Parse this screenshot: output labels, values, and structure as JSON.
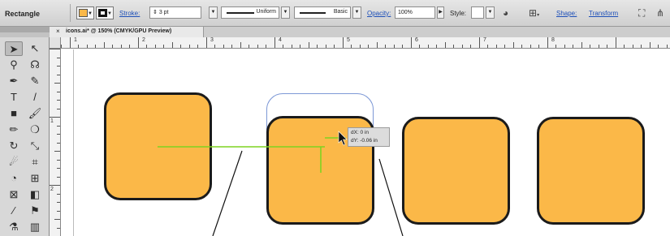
{
  "control_bar": {
    "tool_name": "Rectangle",
    "fill_color": "#fbb848",
    "stroke_color": "#111111",
    "stroke_label": "Stroke:",
    "stroke_weight": "3 pt",
    "profile": "Uniform",
    "brush": "Basic",
    "opacity_label": "Opacity:",
    "opacity_value": "100%",
    "style_label": "Style:",
    "shape_label": "Shape:",
    "transform_label": "Transform"
  },
  "document_tab": {
    "close_glyph": "×",
    "title": "icons.ai* @ 150% (CMYK/GPU Preview)"
  },
  "ruler": {
    "h_numbers": [
      "1",
      "2",
      "3",
      "4",
      "5",
      "6",
      "7",
      "8"
    ],
    "v_numbers": [
      "1",
      "2"
    ]
  },
  "tools": [
    {
      "name": "selection-tool-icon",
      "glyph": "➤"
    },
    {
      "name": "direct-selection-tool-icon",
      "glyph": "↖"
    },
    {
      "name": "magic-wand-tool-icon",
      "glyph": "⚲"
    },
    {
      "name": "lasso-tool-icon",
      "glyph": "☊"
    },
    {
      "name": "pen-tool-icon",
      "glyph": "✒"
    },
    {
      "name": "curvature-tool-icon",
      "glyph": "✎"
    },
    {
      "name": "type-tool-icon",
      "glyph": "T"
    },
    {
      "name": "line-segment-tool-icon",
      "glyph": "/"
    },
    {
      "name": "rectangle-tool-icon",
      "glyph": "■"
    },
    {
      "name": "paintbrush-tool-icon",
      "glyph": "🖌"
    },
    {
      "name": "pencil-tool-icon",
      "glyph": "✏"
    },
    {
      "name": "blob-brush-tool-icon",
      "glyph": "❍"
    },
    {
      "name": "rotate-tool-icon",
      "glyph": "↻"
    },
    {
      "name": "scale-tool-icon",
      "glyph": "⤡"
    },
    {
      "name": "warp-tool-icon",
      "glyph": "☄"
    },
    {
      "name": "free-transform-tool-icon",
      "glyph": "⌗"
    },
    {
      "name": "shape-builder-tool-icon",
      "glyph": "◔"
    },
    {
      "name": "perspective-grid-tool-icon",
      "glyph": "⊞"
    },
    {
      "name": "mesh-tool-icon",
      "glyph": "⊠"
    },
    {
      "name": "gradient-tool-icon",
      "glyph": "◧"
    },
    {
      "name": "eyedropper-tool-icon",
      "glyph": "⁄"
    },
    {
      "name": "blend-tool-icon",
      "glyph": "⚑"
    },
    {
      "name": "symbol-sprayer-tool-icon",
      "glyph": "⚗"
    },
    {
      "name": "column-graph-tool-icon",
      "glyph": "▥"
    }
  ],
  "smart_guide_tooltip": {
    "dx": "dX: 0 in",
    "dy": "dY: -0.06 in"
  },
  "colors": {
    "fill": "#fbb848",
    "outline": "#1b1b1b",
    "smart_guide": "#7ed321",
    "bounding_box": "#7d98d6"
  }
}
